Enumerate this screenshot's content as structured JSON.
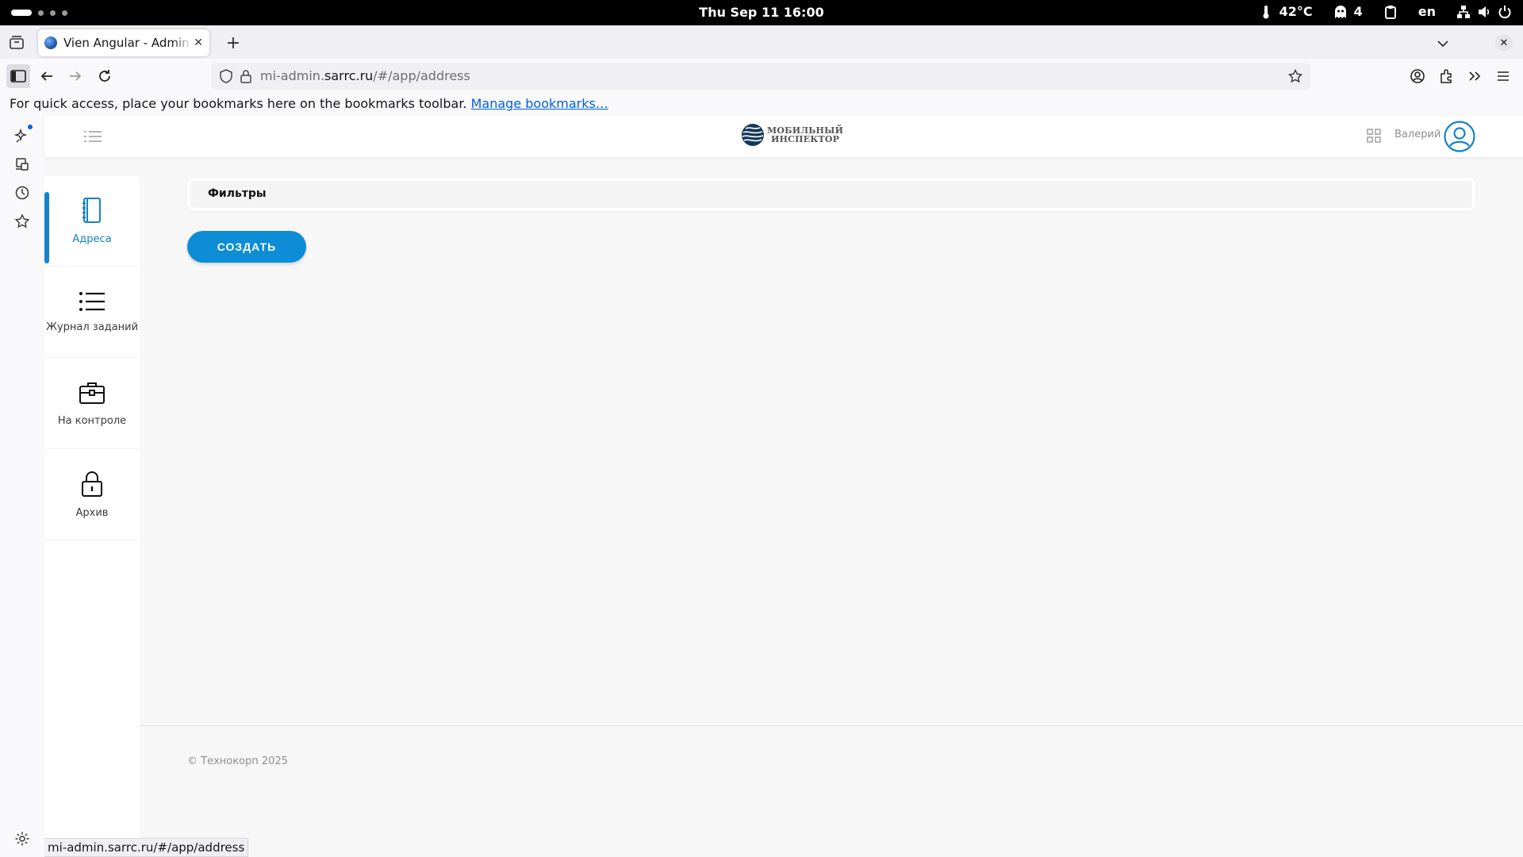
{
  "os": {
    "clock": "Thu Sep 11  16:00",
    "temperature": "42°C",
    "notifications_count": "4",
    "language": "en",
    "icons": [
      "thermometer-icon",
      "ghost-icon",
      "clipboard-icon",
      "network-icon",
      "volume-icon",
      "power-icon"
    ]
  },
  "browser": {
    "tab_title": "Vien Angular - Admin Template",
    "url_domain_prefix": "mi-admin.",
    "url_domain": "sarrc.ru",
    "url_path": "/#/app/address",
    "bookmarks_text": "For quick access, place your bookmarks here on the bookmarks toolbar.",
    "bookmarks_link": "Manage bookmarks…",
    "status_url": "mi-admin.sarrc.ru/#/app/address"
  },
  "app": {
    "logo_line1": "МОБИЛЬНЫЙ",
    "logo_line2": "ИНСПЕКТОР",
    "user_name": "Валерий",
    "sidebar": {
      "items": [
        {
          "label": "Адреса",
          "icon": "address-book-icon",
          "active": true
        },
        {
          "label": "Журнал заданий",
          "icon": "list-icon",
          "active": false
        },
        {
          "label": "На контроле",
          "icon": "briefcase-icon",
          "active": false
        },
        {
          "label": "Архив",
          "icon": "lock-icon",
          "active": false
        }
      ]
    },
    "filters_label": "Фильтры",
    "create_label": "СОЗДАТЬ",
    "footer": "© Технокорп 2025",
    "accent_color": "#0c8dd6"
  }
}
